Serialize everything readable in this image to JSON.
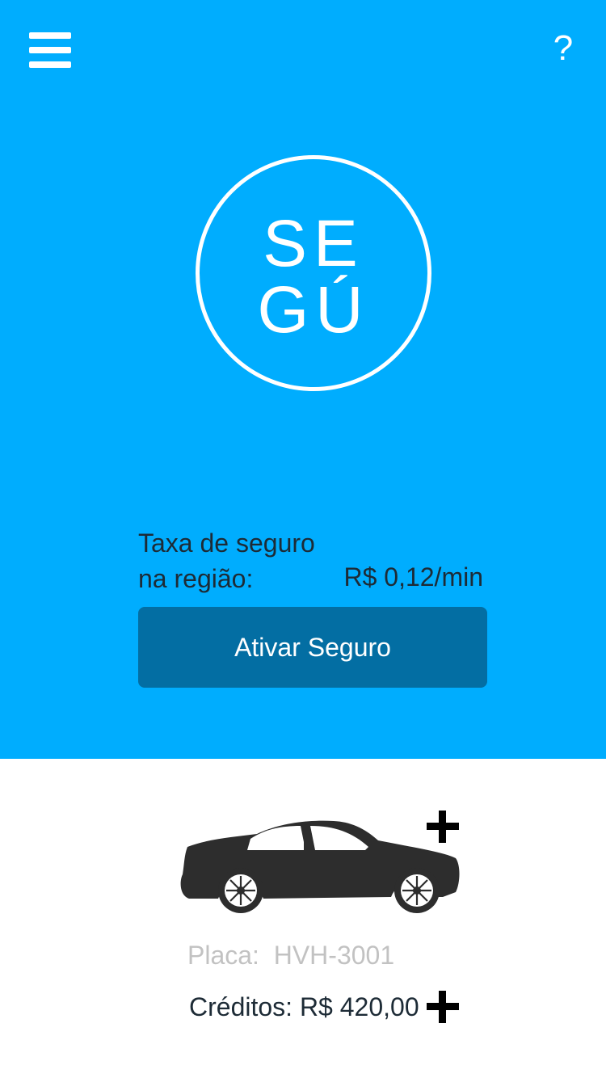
{
  "header": {
    "menu_icon": "hamburger-menu-icon",
    "help_label": "?"
  },
  "logo": {
    "line1": "SE",
    "line2": "GÚ"
  },
  "insurance": {
    "rate_label_line1": "Taxa de seguro",
    "rate_label_line2": "na região:",
    "rate_value": "R$ 0,12/min",
    "activate_label": "Ativar Seguro"
  },
  "vehicle": {
    "add_icon": "plus-icon",
    "plate_label": "Placa:",
    "plate_value": "HVH-3001",
    "credits_label": "Créditos:",
    "credits_value": "R$ 420,00"
  },
  "colors": {
    "primary_blue": "#00adfe",
    "button_blue": "#036ea3",
    "dark_text": "#1d2b36",
    "muted_text": "#c2c2c2"
  }
}
